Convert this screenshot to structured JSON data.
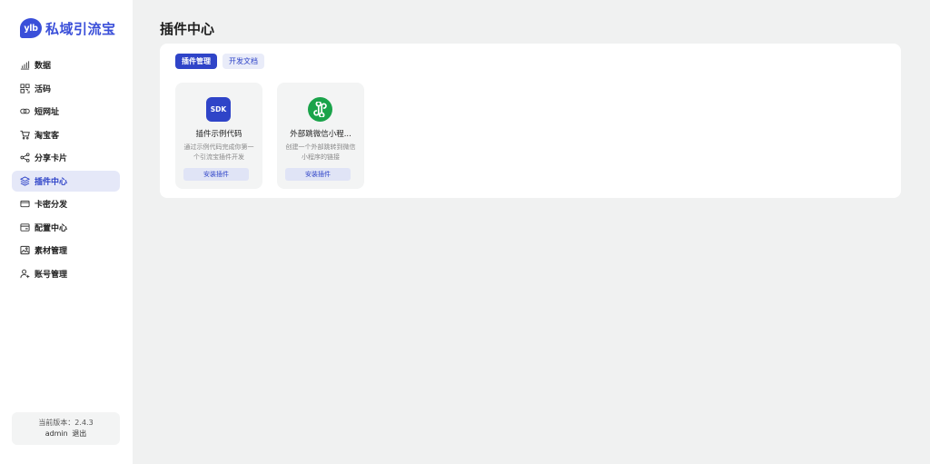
{
  "brand": {
    "logo_text": "ylb",
    "name": "私域引流宝",
    "accent": "#3a4fd9"
  },
  "sidebar": {
    "items": [
      {
        "label": "数据",
        "icon": "bar-chart-icon",
        "active": false
      },
      {
        "label": "活码",
        "icon": "qr-code-icon",
        "active": false
      },
      {
        "label": "短网址",
        "icon": "link-icon",
        "active": false
      },
      {
        "label": "淘宝客",
        "icon": "cart-icon",
        "active": false
      },
      {
        "label": "分享卡片",
        "icon": "share-icon",
        "active": false
      },
      {
        "label": "插件中心",
        "icon": "layers-icon",
        "active": true
      },
      {
        "label": "卡密分发",
        "icon": "card-icon",
        "active": false
      },
      {
        "label": "配置中心",
        "icon": "config-icon",
        "active": false
      },
      {
        "label": "素材管理",
        "icon": "image-icon",
        "active": false
      },
      {
        "label": "账号管理",
        "icon": "user-add-icon",
        "active": false
      }
    ],
    "version_text": "当前版本：2.4.3",
    "user": "admin",
    "logout_label": "退出"
  },
  "main": {
    "title": "插件中心",
    "tabs": [
      {
        "label": "插件管理",
        "active": true
      },
      {
        "label": "开发文档",
        "active": false
      }
    ],
    "cards": [
      {
        "icon": "sdk-icon",
        "icon_text": "SDK",
        "title": "插件示例代码",
        "desc": "通过示例代码完成你第一个引流宝插件开发",
        "button": "安装插件"
      },
      {
        "icon": "mini-program-icon",
        "icon_text": "",
        "title": "外部跳微信小程...",
        "desc": "创建一个外部跳转到微信小程序的链接",
        "button": "安装插件"
      }
    ]
  },
  "colors": {
    "primary": "#2f44c8",
    "mini_program_green": "#1aa34a",
    "background": "#f0f1f1"
  }
}
